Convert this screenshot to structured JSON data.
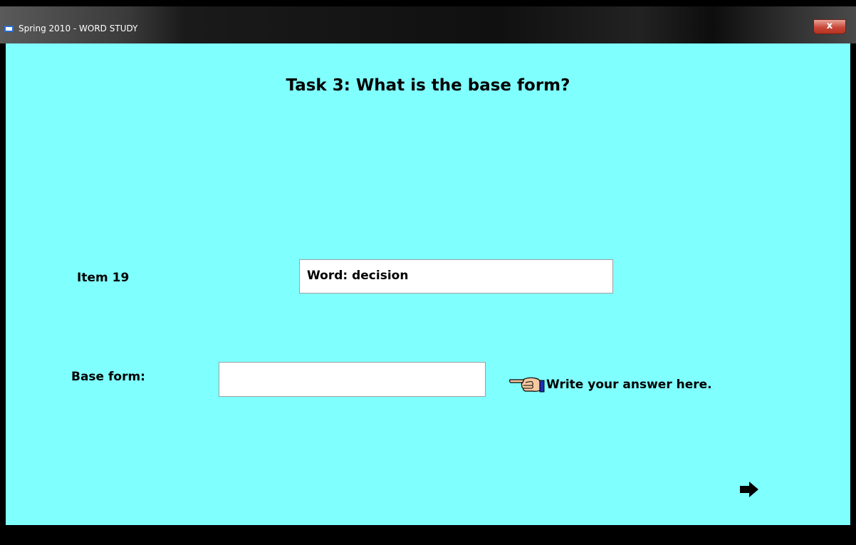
{
  "window": {
    "title": "Spring 2010 - WORD STUDY",
    "close_label": "x"
  },
  "task": {
    "title": "Task 3: What is the base form?"
  },
  "item": {
    "label": "Item 19",
    "word_text": "Word: decision"
  },
  "answer": {
    "label": "Base form:",
    "value": "",
    "placeholder": "",
    "hint": "Write your answer here."
  },
  "icons": {
    "window_icon": "app-window-icon",
    "close": "close-icon",
    "hand": "pointing-hand-icon",
    "next": "right-arrow-icon"
  },
  "colors": {
    "background": "#80ffff",
    "titlebar": "#111111",
    "close_button": "#c9473a"
  }
}
